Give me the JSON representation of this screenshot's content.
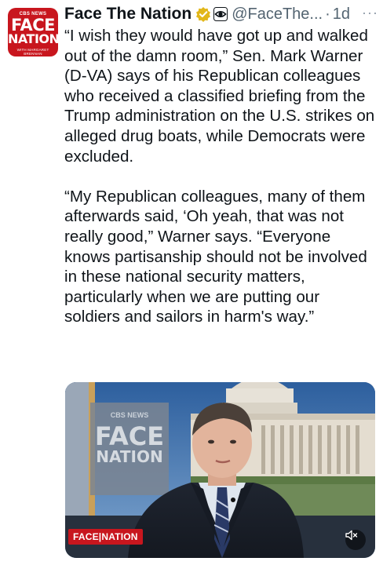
{
  "tweet": {
    "author_name": "Face The Nation",
    "handle": "@FaceThe...",
    "separator": "·",
    "time": "1d",
    "more_label": "···",
    "avatar": {
      "network": "CBS NEWS",
      "line1": "FACE",
      "line2": "NATION",
      "subline": "WITH MARGARET BRENNAN"
    },
    "paragraphs": [
      "“I wish they would have got up and walked out of the damn room,” Sen. Mark Warner (D-VA) says of his Republican colleagues who received a classified briefing from the Trump administration on the U.S. strikes on alleged drug boats, while Democrats were excluded.",
      "“My Republican colleagues, many of them afterwards said, ‘Oh yeah, that was not really good,” Warner says. “Everyone knows partisanship should not be involved in these national security matters, particularly when we are putting our soldiers and sailors in harm's way.”"
    ],
    "media": {
      "backdrop_sign_network": "CBS NEWS",
      "backdrop_sign_line1": "FACE",
      "backdrop_sign_line2": "NATION",
      "bug_label": "FACE|NATION",
      "mute_icon": "speaker-muted-icon"
    }
  },
  "colors": {
    "text": "#0f1419",
    "secondary": "#536471",
    "verified_gold": "#e2b719",
    "cbs_red": "#c8161e"
  }
}
